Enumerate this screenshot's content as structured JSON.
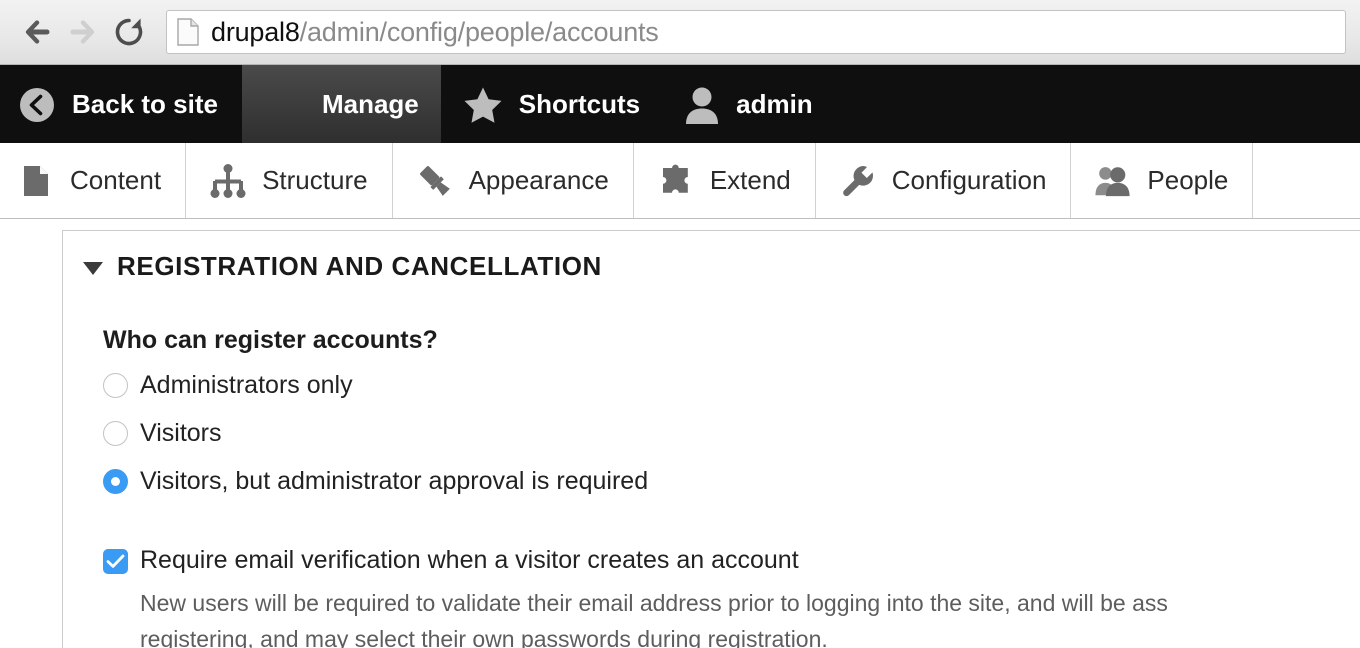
{
  "browser": {
    "back_icon": "back-arrow-icon",
    "forward_icon": "forward-arrow-icon",
    "reload_icon": "reload-icon",
    "page_icon": "page-document-icon",
    "url_domain": "drupal8",
    "url_path": "/admin/config/people/accounts",
    "url_full": "drupal8/admin/config/people/accounts"
  },
  "toolbar": {
    "back_to_site": "Back to site",
    "manage": "Manage",
    "shortcuts": "Shortcuts",
    "user": "admin",
    "back_icon": "back-circle-icon",
    "manage_icon": "hamburger-icon",
    "shortcuts_icon": "star-icon",
    "user_icon": "person-icon",
    "active": "Manage"
  },
  "menu": {
    "items": [
      {
        "label": "Content",
        "icon": "document-icon"
      },
      {
        "label": "Structure",
        "icon": "sitemap-icon"
      },
      {
        "label": "Appearance",
        "icon": "paintbrush-icon"
      },
      {
        "label": "Extend",
        "icon": "puzzle-piece-icon"
      },
      {
        "label": "Configuration",
        "icon": "wrench-icon"
      },
      {
        "label": "People",
        "icon": "people-icon"
      }
    ]
  },
  "form": {
    "details_title": "REGISTRATION AND CANCELLATION",
    "details_expanded": true,
    "who_can_register_label": "Who can register accounts?",
    "radios": [
      {
        "label": "Administrators only",
        "checked": false
      },
      {
        "label": "Visitors",
        "checked": false
      },
      {
        "label": "Visitors, but administrator approval is required",
        "checked": true
      }
    ],
    "email_verification": {
      "label": "Require email verification when a visitor creates an account",
      "checked": true,
      "description_line_1": "New users will be required to validate their email address prior to logging into the site, and will be ass",
      "description_line_2": "registering, and may select their own passwords during registration."
    }
  },
  "colors": {
    "accent_blue": "#3a9bf4",
    "toolbar_dark": "#0f0f0f",
    "toolbar_active": "#3b3b3b",
    "menu_icon_gray": "#6b6b6b",
    "description_gray": "#5d5d5d"
  }
}
